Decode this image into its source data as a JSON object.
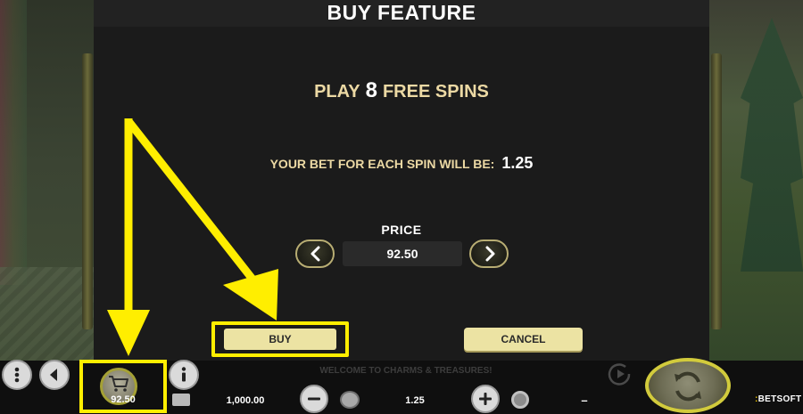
{
  "modal": {
    "title": "BUY FEATURE",
    "headline_prefix": "PLAY",
    "free_spins_count": "8",
    "headline_suffix": "FREE SPINS",
    "bet_label": "YOUR BET FOR EACH SPIN WILL BE:",
    "bet_value": "1.25",
    "price_label": "PRICE",
    "price_value": "92.50",
    "buy_label": "BUY",
    "cancel_label": "CANCEL"
  },
  "bottom_bar": {
    "marquee": "WELCOME TO CHARMS & TREASURES!",
    "buy_feature_price": "92.50",
    "balance": "1,000.00",
    "bet": "1.25",
    "win": "–",
    "brand_prefix": "BETSOFT",
    "brand_accent": ":"
  },
  "icons": {
    "menu": "menu-dots-icon",
    "sound": "speaker-icon",
    "buy_feature": "cart-icon",
    "info": "info-icon",
    "wallet": "wallet-icon",
    "coins": "coins-icon",
    "ribbon": "award-ribbon-icon",
    "autoplay": "autoplay-icon",
    "spin": "spin-arrows-icon",
    "prev": "chevron-left-icon",
    "next": "chevron-right-icon"
  },
  "colors": {
    "highlight": "#ffee00",
    "gold_text": "#ecd9a4",
    "button_bg": "#ece3a3",
    "modal_bg": "#1b1b1b"
  }
}
